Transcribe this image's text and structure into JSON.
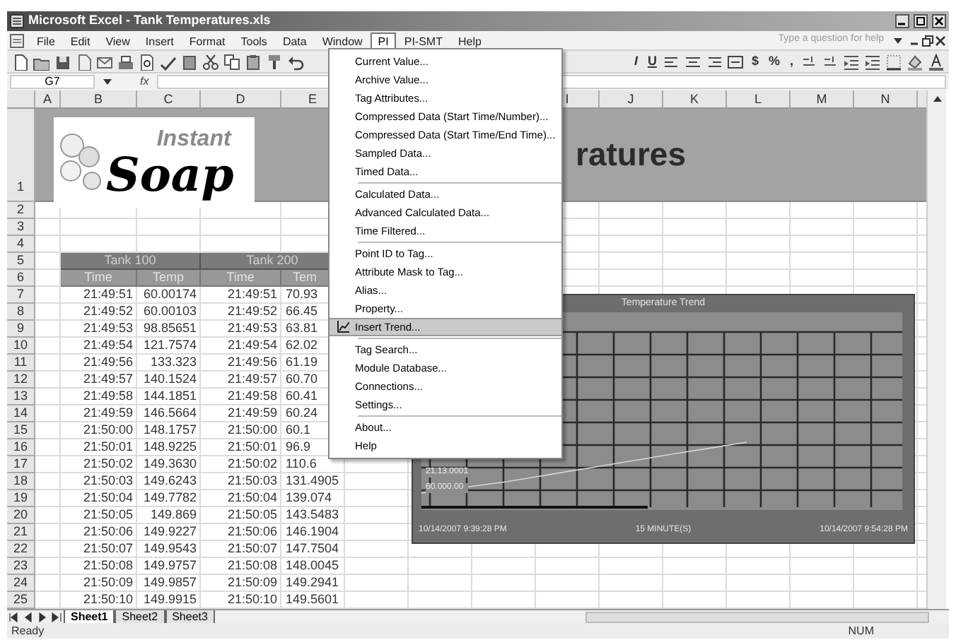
{
  "window": {
    "title": "Microsoft Excel - Tank Temperatures.xls",
    "help_placeholder": "Type a question for help"
  },
  "menu_bar": [
    {
      "label": "File",
      "selected": false
    },
    {
      "label": "Edit",
      "selected": false
    },
    {
      "label": "View",
      "selected": false
    },
    {
      "label": "Insert",
      "selected": false
    },
    {
      "label": "Format",
      "selected": false
    },
    {
      "label": "Tools",
      "selected": false
    },
    {
      "label": "Data",
      "selected": false
    },
    {
      "label": "Window",
      "selected": false
    },
    {
      "label": "PI",
      "selected": true
    },
    {
      "label": "PI-SMT",
      "selected": false
    },
    {
      "label": "Help",
      "selected": false
    }
  ],
  "format_toolbar": {
    "style_buttons": [
      "I",
      "U"
    ],
    "number_buttons": [
      "$",
      "%",
      ","
    ]
  },
  "formula_bar": {
    "name_box": "G7",
    "function_label": "fx"
  },
  "column_headers_left": [
    "A",
    "B",
    "C",
    "D",
    "E"
  ],
  "column_headers_right": [
    "I",
    "J",
    "K",
    "L",
    "M",
    "N"
  ],
  "row_numbers": [
    "1",
    "2",
    "3",
    "4",
    "5",
    "6",
    "7",
    "8",
    "9",
    "10",
    "11",
    "12",
    "13",
    "14",
    "15",
    "16",
    "17",
    "18",
    "19",
    "20",
    "21",
    "22",
    "23",
    "24",
    "25"
  ],
  "logo": {
    "line_1": "Instant",
    "line_2": "Soap"
  },
  "title_banner": {
    "text": "ratures"
  },
  "table": {
    "group_headers": [
      "Tank 100",
      "Tank 200"
    ],
    "columns": [
      "Time",
      "Temp",
      "Time",
      "Tem"
    ],
    "rows": [
      [
        "21:49:51",
        "60.00174",
        "21:49:51",
        "70.93"
      ],
      [
        "21:49:52",
        "60.00103",
        "21:49:52",
        "66.45"
      ],
      [
        "21:49:53",
        "98.85651",
        "21:49:53",
        "63.81"
      ],
      [
        "21:49:54",
        "121.7574",
        "21:49:54",
        "62.02"
      ],
      [
        "21:49:56",
        "133.323",
        "21:49:56",
        "61.19"
      ],
      [
        "21:49:57",
        "140.1524",
        "21:49:57",
        "60.70"
      ],
      [
        "21:49:58",
        "144.1851",
        "21:49:58",
        "60.41"
      ],
      [
        "21:49:59",
        "146.5664",
        "21:49:59",
        "60.24"
      ],
      [
        "21:50:00",
        "148.1757",
        "21:50:00",
        "60.1"
      ],
      [
        "21:50:01",
        "148.9225",
        "21:50:01",
        "96.9"
      ],
      [
        "21:50:02",
        "149.3630",
        "21:50:02",
        "110.6"
      ],
      [
        "21:50:03",
        "149.6243",
        "21:50:03",
        "131.4905"
      ],
      [
        "21:50:04",
        "149.7782",
        "21:50:04",
        "139.074"
      ],
      [
        "21:50:05",
        "149.869",
        "21:50:05",
        "143.5483"
      ],
      [
        "21:50:06",
        "149.9227",
        "21:50:06",
        "146.1904"
      ],
      [
        "21:50:07",
        "149.9543",
        "21:50:07",
        "147.7504"
      ],
      [
        "21:50:08",
        "149.9757",
        "21:50:08",
        "148.0045"
      ],
      [
        "21:50:09",
        "149.9857",
        "21:50:09",
        "149.2941"
      ],
      [
        "21:50:10",
        "149.9915",
        "21:50:10",
        "149.5601"
      ]
    ]
  },
  "pi_menu": {
    "sections": [
      {
        "items": [
          {
            "label": "Current Value...",
            "selected": false
          },
          {
            "label": "Archive Value...",
            "selected": false
          },
          {
            "label": "Tag Attributes...",
            "selected": false
          },
          {
            "label": "Compressed Data (Start Time/Number)...",
            "selected": false
          },
          {
            "label": "Compressed Data (Start Time/End Time)...",
            "selected": false
          },
          {
            "label": "Sampled Data...",
            "selected": false
          },
          {
            "label": "Timed Data...",
            "selected": false
          }
        ]
      },
      {
        "items": [
          {
            "label": "Calculated Data...",
            "selected": false
          },
          {
            "label": "Advanced Calculated Data...",
            "selected": false
          },
          {
            "label": "Time Filtered...",
            "selected": false
          }
        ]
      },
      {
        "items": [
          {
            "label": "Point ID to Tag...",
            "selected": false
          },
          {
            "label": "Attribute Mask to Tag...",
            "selected": false
          },
          {
            "label": "Alias...",
            "selected": false
          },
          {
            "label": "Property...",
            "selected": false
          },
          {
            "label": "Insert Trend...",
            "selected": true
          }
        ]
      },
      {
        "items": [
          {
            "label": "Tag Search...",
            "selected": false
          },
          {
            "label": "Module Database...",
            "selected": false
          },
          {
            "label": "Connections...",
            "selected": false
          },
          {
            "label": "Settings...",
            "selected": false
          }
        ]
      },
      {
        "items": [
          {
            "label": "About...",
            "selected": false
          },
          {
            "label": "Help",
            "selected": false
          }
        ]
      }
    ]
  },
  "chart": {
    "title": "Temperature Trend",
    "scale_labels": [
      "21.13.0001",
      "60.000.00"
    ],
    "start_time": "10/14/2007 9:39:28 PM",
    "span": "15 MINUTE(S)",
    "end_time": "10/14/2007 9:54:28 PM"
  },
  "sheet_tabs": [
    {
      "label": "Sheet1",
      "selected": true
    },
    {
      "label": "Sheet2",
      "selected": false
    },
    {
      "label": "Sheet3",
      "selected": false
    }
  ],
  "status_bar": {
    "left": "Ready",
    "right": "NUM"
  }
}
